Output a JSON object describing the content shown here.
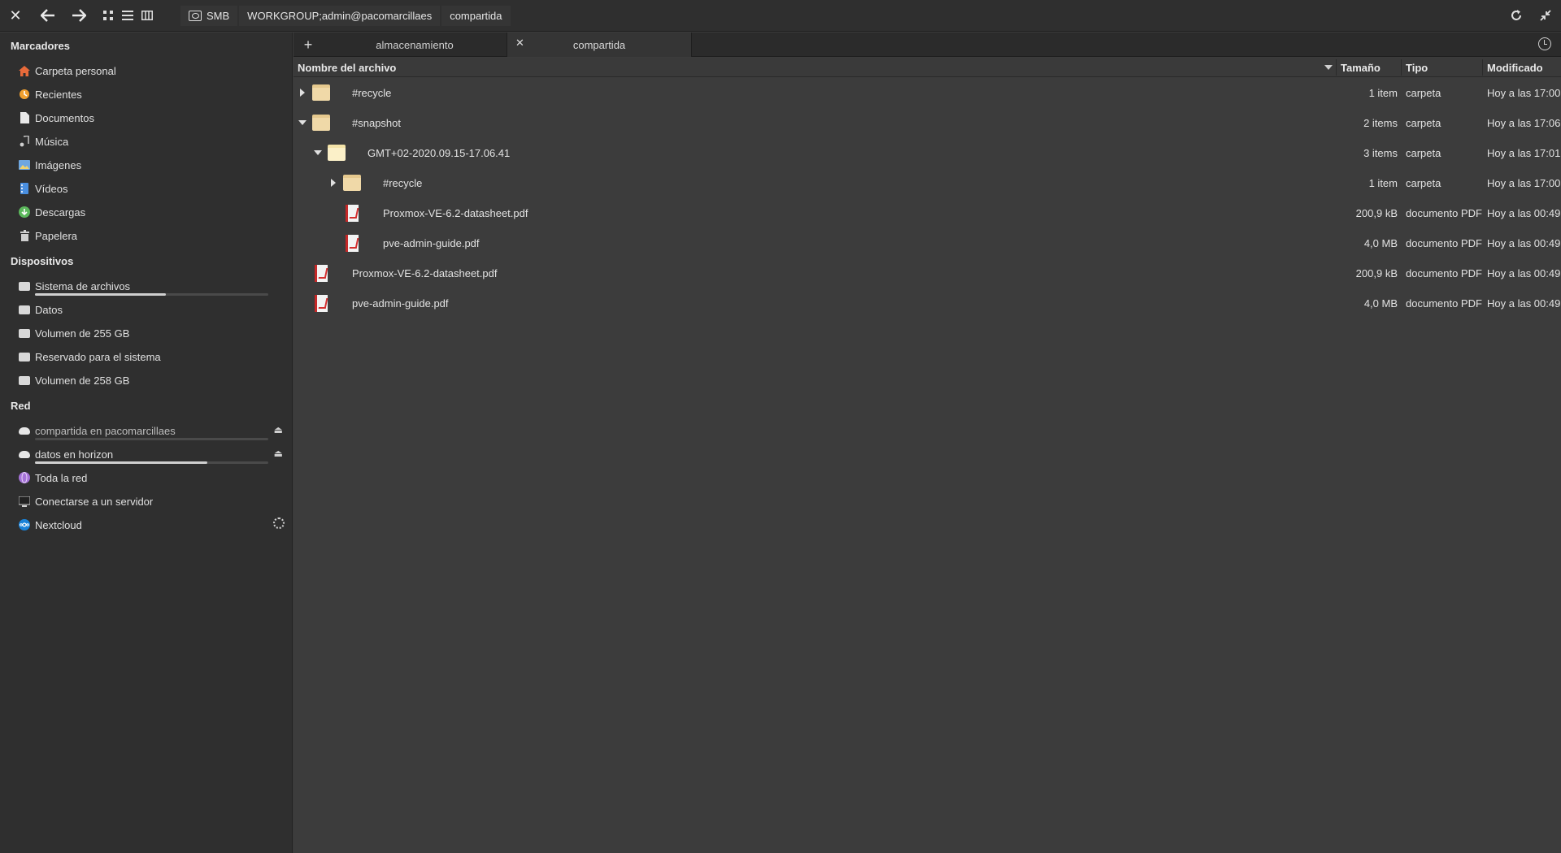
{
  "header": {
    "path": [
      "SMB",
      "WORKGROUP;admin@pacomarcillaes",
      "compartida"
    ]
  },
  "sidebar": {
    "bookmarks_title": "Marcadores",
    "bookmarks": [
      {
        "label": "Carpeta personal",
        "icon": "home-icon"
      },
      {
        "label": "Recientes",
        "icon": "recent-icon"
      },
      {
        "label": "Documentos",
        "icon": "document-icon"
      },
      {
        "label": "Música",
        "icon": "music-icon"
      },
      {
        "label": "Imágenes",
        "icon": "pictures-icon"
      },
      {
        "label": "Vídeos",
        "icon": "videos-icon"
      },
      {
        "label": "Descargas",
        "icon": "downloads-icon"
      },
      {
        "label": "Papelera",
        "icon": "trash-icon"
      }
    ],
    "devices_title": "Dispositivos",
    "devices": [
      {
        "label": "Sistema de archivos",
        "usage": 0.56
      },
      {
        "label": "Datos"
      },
      {
        "label": "Volumen de 255 GB"
      },
      {
        "label": "Reservado para el sistema"
      },
      {
        "label": "Volumen de 258 GB"
      }
    ],
    "network_title": "Red",
    "network": [
      {
        "label": "compartida en pacomarcillaes",
        "usage": 0.0
      },
      {
        "label": "datos en horizon",
        "usage": 0.74
      },
      {
        "label": "Toda la red"
      },
      {
        "label": "Conectarse a un servidor"
      },
      {
        "label": "Nextcloud"
      }
    ]
  },
  "tabs": [
    {
      "label": "almacenamiento"
    },
    {
      "label": "compartida"
    }
  ],
  "columns": {
    "name": "Nombre del archivo",
    "size": "Tamaño",
    "type": "Tipo",
    "modified": "Modificado"
  },
  "rows": [
    {
      "name": "#recycle",
      "size": "1 item",
      "type": "carpeta",
      "modified": "Hoy a las 17:00"
    },
    {
      "name": "#snapshot",
      "size": "2 items",
      "type": "carpeta",
      "modified": "Hoy a las 17:06"
    },
    {
      "name": "GMT+02-2020.09.15-17.06.41",
      "size": "3 items",
      "type": "carpeta",
      "modified": "Hoy a las 17:01"
    },
    {
      "name": "#recycle",
      "size": "1 item",
      "type": "carpeta",
      "modified": "Hoy a las 17:00"
    },
    {
      "name": "Proxmox-VE-6.2-datasheet.pdf",
      "size": "200,9 kB",
      "type": "documento PDF",
      "modified": "Hoy a las 00:49"
    },
    {
      "name": "pve-admin-guide.pdf",
      "size": "4,0 MB",
      "type": "documento PDF",
      "modified": "Hoy a las 00:49"
    },
    {
      "name": "Proxmox-VE-6.2-datasheet.pdf",
      "size": "200,9 kB",
      "type": "documento PDF",
      "modified": "Hoy a las 00:49"
    },
    {
      "name": "pve-admin-guide.pdf",
      "size": "4,0 MB",
      "type": "documento PDF",
      "modified": "Hoy a las 00:49"
    }
  ]
}
